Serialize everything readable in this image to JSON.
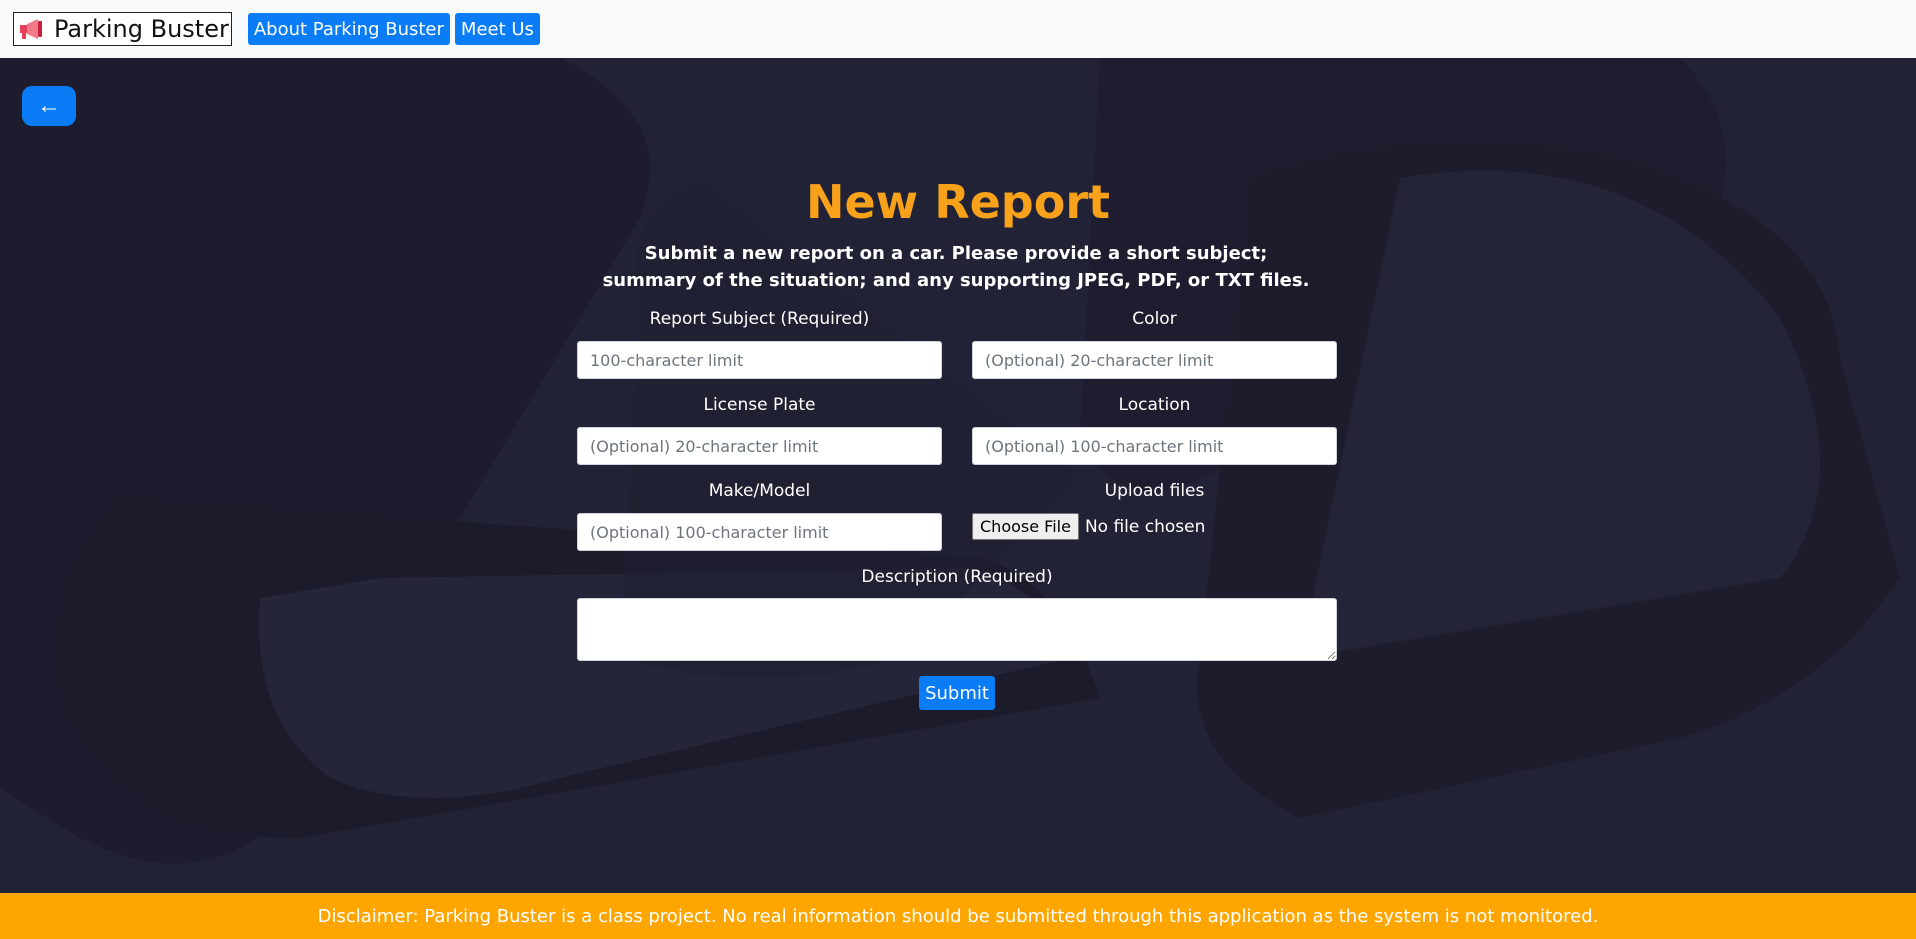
{
  "nav": {
    "brand": "Parking Buster",
    "brand_icon": "megaphone-icon",
    "links": [
      "About Parking Buster",
      "Meet Us"
    ]
  },
  "back": {
    "label": "←"
  },
  "page": {
    "title": "New Report",
    "subtitle": "Submit a new report on a car. Please provide a short subject; summary of the situation; and any supporting JPEG, PDF, or TXT files."
  },
  "form": {
    "subject": {
      "label": "Report Subject (Required)",
      "placeholder": "100-character limit",
      "value": ""
    },
    "color": {
      "label": "Color",
      "placeholder": "(Optional) 20-character limit",
      "value": ""
    },
    "plate": {
      "label": "License Plate",
      "placeholder": "(Optional) 20-character limit",
      "value": ""
    },
    "location": {
      "label": "Location",
      "placeholder": "(Optional) 100-character limit",
      "value": ""
    },
    "make": {
      "label": "Make/Model",
      "placeholder": "(Optional) 100-character limit",
      "value": ""
    },
    "upload": {
      "label": "Upload files",
      "button": "Choose File",
      "status": "No file chosen"
    },
    "description": {
      "label": "Description (Required)",
      "value": ""
    },
    "submit": "Submit"
  },
  "disclaimer": "Disclaimer: Parking Buster is a class project. No real information should be submitted through this application as the system is not monitored.",
  "colors": {
    "accent": "#0a7cf5",
    "title": "#f7a21a",
    "disclaimer_bg": "#ffa500",
    "background": "#1f1f33"
  }
}
